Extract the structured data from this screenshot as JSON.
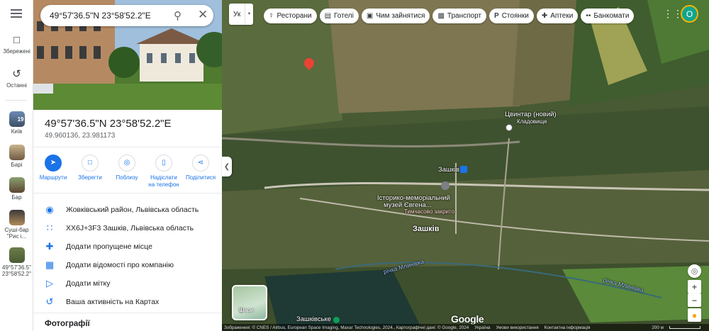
{
  "rail": {
    "saved_label": "Збережені",
    "recent_label": "Останні",
    "recent_places": [
      {
        "label": "Київ",
        "badge": "19"
      },
      {
        "label": "Барі"
      },
      {
        "label": "Бар"
      },
      {
        "label": "Суші-бар \"Рис і..."
      },
      {
        "label": "49°57'36.5\" 23°58'52.2\""
      }
    ]
  },
  "search": {
    "value": "49°57'36.5\"N 23°58'52.2\"E"
  },
  "place": {
    "title": "49°57'36.5\"N 23°58'52.2\"E",
    "decimal": "49.960136, 23.981173"
  },
  "actions": [
    {
      "label": "Маршрути",
      "icon": "directions-icon"
    },
    {
      "label": "Зберегти",
      "icon": "bookmark-icon"
    },
    {
      "label": "Поблизу",
      "icon": "nearby-icon"
    },
    {
      "label": "Надіслати на телефон",
      "icon": "send-to-phone-icon"
    },
    {
      "label": "Поділитися",
      "icon": "share-icon"
    }
  ],
  "details": [
    {
      "text": "Жовківський район, Львівська область",
      "icon": "location-pin-icon"
    },
    {
      "text": "XX6J+3F3 Зашків, Львівська область",
      "icon": "plus-code-icon"
    },
    {
      "text": "Додати пропущене місце",
      "icon": "add-place-icon"
    },
    {
      "text": "Додати відомості про компанію",
      "icon": "add-business-icon"
    },
    {
      "text": "Додати мітку",
      "icon": "label-icon"
    },
    {
      "text": "Ваша активність на Картах",
      "icon": "history-icon"
    }
  ],
  "photos_heading": "Фотографії",
  "map": {
    "language_value": "Ук",
    "chips": [
      {
        "label": "Ресторани",
        "icon": "restaurant-icon"
      },
      {
        "label": "Готелі",
        "icon": "hotel-icon"
      },
      {
        "label": "Чим зайнятися",
        "icon": "camera-icon"
      },
      {
        "label": "Транспорт",
        "icon": "transit-icon"
      },
      {
        "label": "Стоянки",
        "icon": "parking-icon"
      },
      {
        "label": "Аптеки",
        "icon": "pharmacy-icon"
      },
      {
        "label": "Банкомати",
        "icon": "atm-icon"
      }
    ],
    "avatar_letter": "О",
    "labels": {
      "cemetery": "Цвинтар (новий)",
      "cemetery_sub": "Кладовище",
      "bus_stop": "Зашків",
      "museum_line1": "Історико-меморіальний",
      "museum_line2": "музей Євгена...",
      "museum_status": "Тимчасово закрито",
      "village": "Зашків",
      "river_left": "річка Млинівка",
      "river_right": "річка Млинівка",
      "station": "Зашківське"
    },
    "layers_label": "Шари",
    "google_logo": "Google",
    "footer": {
      "imagery": "Зображення: © CNES / Airbus, European Space Imaging, Maxar Technologies, 2024., Картографічні дані: © Google, 2024",
      "country": "Україна",
      "terms": "Умови використання",
      "feedback": "Контактна інформація",
      "scale": "200 м"
    }
  },
  "colors": {
    "accent": "#1a73e8",
    "pin": "#ea4335",
    "avatar_bg": "#12a58e"
  }
}
